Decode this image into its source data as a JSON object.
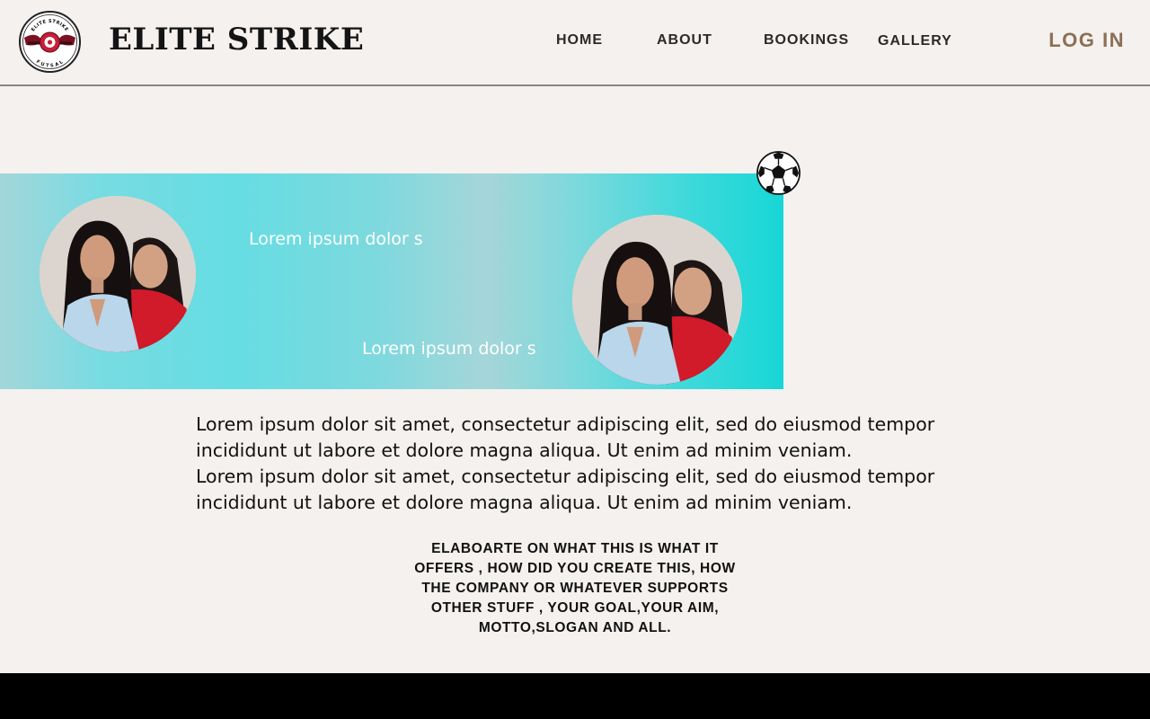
{
  "header": {
    "logo": {
      "top_text": "ELITE STRIKE",
      "bottom_text": "FUTSAL"
    },
    "brand": "ELITE STRIKE",
    "nav": [
      "HOME",
      "ABOUT",
      "BOOKINGS",
      "GALLERY"
    ],
    "login": "LOG IN"
  },
  "banner": {
    "text1": "Lorem ipsum dolor s",
    "text2": "Lorem ipsum dolor s"
  },
  "content": {
    "paragraph_lines": [
      "Lorem ipsum dolor sit amet, consectetur adipiscing elit, sed do eiusmod tempor",
      "incididunt ut labore et dolore magna aliqua. Ut enim ad minim veniam.",
      "Lorem ipsum dolor sit amet, consectetur adipiscing elit, sed do eiusmod tempor",
      "incididunt ut labore et dolore magna aliqua. Ut enim ad minim veniam."
    ],
    "tagline_lines": [
      "ELABOARTE ON WHAT THIS IS WHAT IT",
      "OFFERS , HOW DID YOU CREATE THIS, HOW",
      "THE COMPANY OR WHATEVER SUPPORTS",
      "OTHER STUFF , YOUR GOAL,YOUR AIM,",
      "MOTTO,SLOGAN AND ALL."
    ]
  },
  "colors": {
    "background": "#f4f1ee",
    "login": "#8b6f55",
    "banner_accent": "#17d7d6",
    "footer": "#000000"
  },
  "icons": [
    "futsal-logo-icon",
    "soccer-ball-icon"
  ]
}
